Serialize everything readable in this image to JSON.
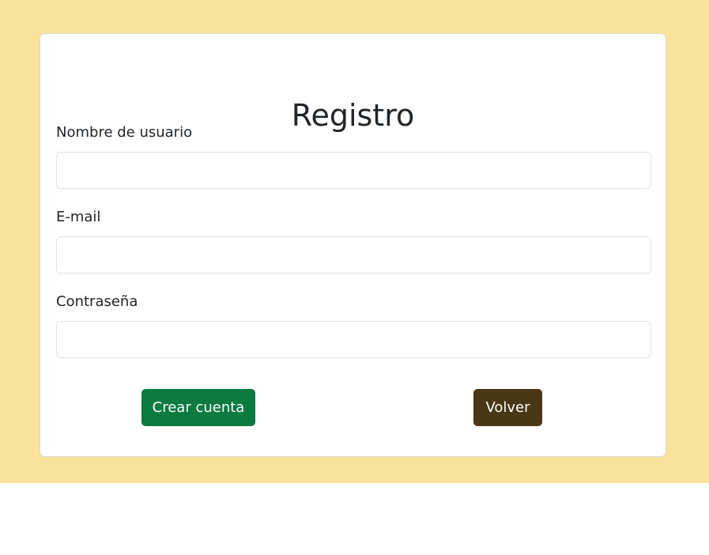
{
  "form": {
    "title": "Registro",
    "fields": [
      {
        "label": "Nombre de usuario",
        "value": "",
        "placeholder": "",
        "type": "text"
      },
      {
        "label": "E-mail",
        "value": "",
        "placeholder": "",
        "type": "email"
      },
      {
        "label": "Contraseña",
        "value": "",
        "placeholder": "",
        "type": "password"
      }
    ],
    "buttons": {
      "create_label": "Crear cuenta",
      "back_label": "Volver"
    }
  },
  "colors": {
    "page_background": "#f9e39a",
    "card_background": "#ffffff",
    "create_button": "#0b7a3e",
    "back_button": "#4a3716",
    "text": "#212529"
  }
}
